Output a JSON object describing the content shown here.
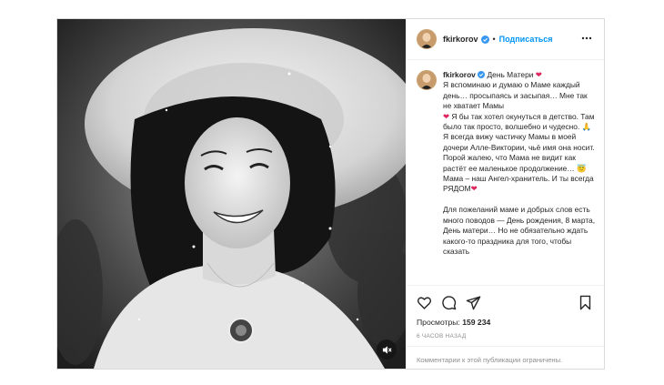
{
  "colors": {
    "accent": "#0095f6",
    "verified": "#3897f0",
    "heart": "#e0245e",
    "muted": "#8e8e8e"
  },
  "header": {
    "username": "fkirkorov",
    "follow_label": "Подписаться",
    "more_icon": "more-horizontal-icon"
  },
  "caption": {
    "username": "fkirkorov",
    "title": "День Матери",
    "lines": [
      "Я вспоминаю и думаю о Маме каждый день… просыпаясь и засыпая… Мне так не хватает Мамы",
      "Я бы так хотел окунуться в детство. Там было так просто, волшебно и чудесно.",
      "Я всегда вижу частичку Мамы в моей дочери Алле-Виктории, чьё имя она носит. Порой жалею, что Мама не видит как растёт ее маленькое продолжение…",
      "Мама – наш Ангел-хранитель. И ты всегда РЯДОМ",
      "Для пожеланий маме и добрых слов есть много поводов — День рождения, 8 марта, День матери… Но не обязательно ждать какого-то праздника для того, чтобы сказать"
    ]
  },
  "stats": {
    "views_label": "Просмотры:",
    "views_value": "159 234",
    "time": "6 часов назад"
  },
  "comments": {
    "disabled_text": "Комментарии к этой публикации ограничены."
  }
}
